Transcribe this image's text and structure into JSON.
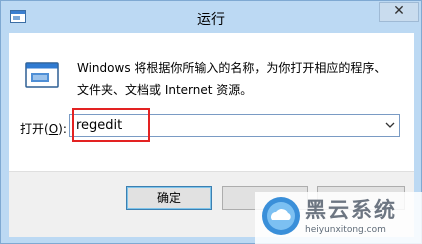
{
  "window": {
    "title": "运行",
    "close_label": "✕"
  },
  "dialog": {
    "description": "Windows 将根据你所输入的名称，为你打开相应的程序、文件夹、文档或 Internet 资源。",
    "open_label_prefix": "打开(",
    "open_label_key": "O",
    "open_label_suffix": "):",
    "input_value": "regedit"
  },
  "buttons": {
    "ok": "确定",
    "cancel": "",
    "browse": ""
  },
  "watermark": {
    "name": "黑云系统",
    "url": "heiyunxitong.com"
  },
  "colors": {
    "frame": "#bcd9f3",
    "highlight": "#e32222",
    "accent": "#3a8fd9"
  }
}
